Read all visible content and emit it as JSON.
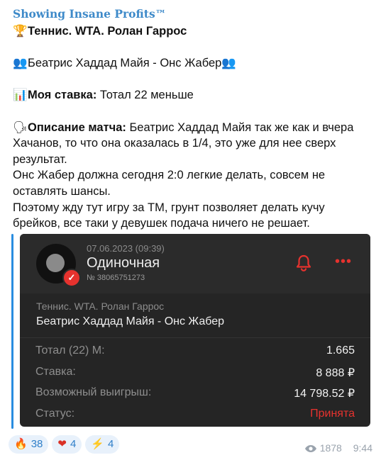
{
  "post": {
    "channel_name": "Showing Insane Profits™",
    "line1": "Теннис. WTA. Ролан Гаррос",
    "line2": "Беатрис Хаддад Майя - Онс Жабер",
    "bet_label": "Моя ставка:",
    "bet_value": " Тотал 22 меньше",
    "desc_label": "Описание матча:",
    "desc_l1": " Беатрис Хаддад Майя так же как и вчера",
    "desc_l2": "Хачанов, то что она оказалась в 1/4, это уже для нее сверх",
    "desc_l3": "результат.",
    "desc_l4": "Онс Жабер должна сегодня 2:0 легкие делать, совсем не",
    "desc_l5": "оставлять шансы.",
    "desc_l6": "Поэтому жду тут игру за ТМ, грунт позволяет делать кучу",
    "desc_l7": "брейков, все таки у девушек подача ничего не решает."
  },
  "card": {
    "date": "07.06.2023 (09:39)",
    "type": "Одиночная",
    "number": "№ 38065751273",
    "league": "Теннис. WTA. Ролан Гаррос",
    "match": "Беатрис Хаддад Майя - Онс Жабер",
    "rows": [
      {
        "label": "Тотал (22) М:",
        "value": "1.665"
      },
      {
        "label": "Ставка:",
        "value": "8 888 ₽"
      },
      {
        "label": "Возможный выигрыш:",
        "value": "14 798.52 ₽"
      },
      {
        "label": "Статус:",
        "value": "Принята"
      }
    ],
    "colors": {
      "accent": "#e6322e",
      "background": "#252525"
    }
  },
  "reactions": [
    {
      "icon": "fire",
      "count": "38"
    },
    {
      "icon": "heart-on-fire",
      "count": "4"
    },
    {
      "icon": "lightning",
      "count": "4"
    }
  ],
  "meta": {
    "views": "1878",
    "time": "9:44"
  }
}
